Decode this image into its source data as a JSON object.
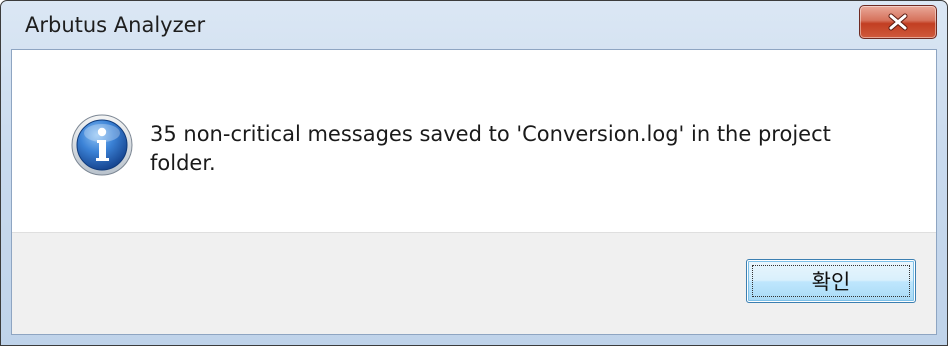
{
  "window": {
    "title": "Arbutus Analyzer"
  },
  "titlebar": {
    "close_icon": "close-icon"
  },
  "message": {
    "icon": "information-icon",
    "text": "35 non-critical messages saved to 'Conversion.log' in the project folder."
  },
  "footer": {
    "ok_label": "확인"
  },
  "colors": {
    "title_gradient_top": "#dbe7f4",
    "close_button_red": "#c23e22",
    "info_icon_blue": "#1f5fb4",
    "ok_button_border": "#3c7fb1",
    "footer_bg": "#f0f0f0"
  }
}
